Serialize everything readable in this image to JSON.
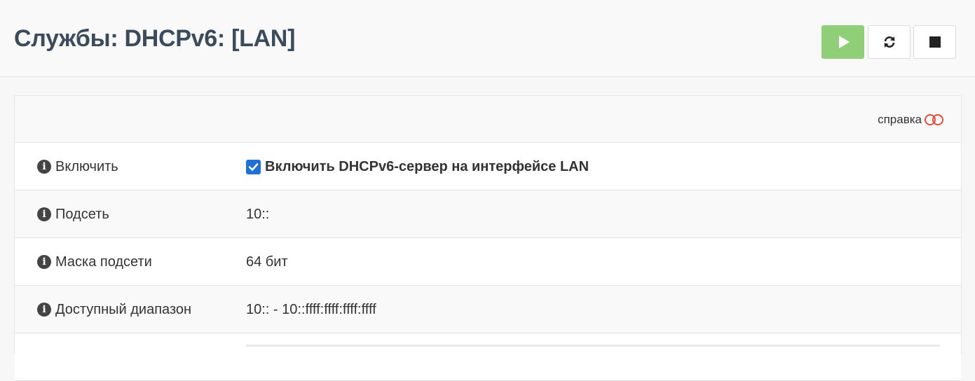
{
  "header": {
    "title": "Службы: DHCPv6: [LAN]",
    "buttons": [
      {
        "name": "start",
        "icon": "play-icon",
        "color": "#8fcf78"
      },
      {
        "name": "restart",
        "icon": "refresh-icon"
      },
      {
        "name": "stop",
        "icon": "stop-icon"
      }
    ]
  },
  "panel": {
    "help_label": "справка",
    "help_icon": "toggle-off-icon",
    "help_color": "#e04c3c",
    "rows": [
      {
        "label": "Включить",
        "value": "Включить DHCPv6-сервер на интерфейсе LAN",
        "checked": true
      },
      {
        "label": "Подсеть",
        "value": "10::"
      },
      {
        "label": "Маска подсети",
        "value": "64 бит"
      },
      {
        "label": "Доступный диапазон",
        "value": "10:: - 10::ffff:ffff:ffff:ffff"
      }
    ]
  },
  "colors": {
    "accent": "#1f6fd6",
    "title": "#3c4b5c"
  }
}
